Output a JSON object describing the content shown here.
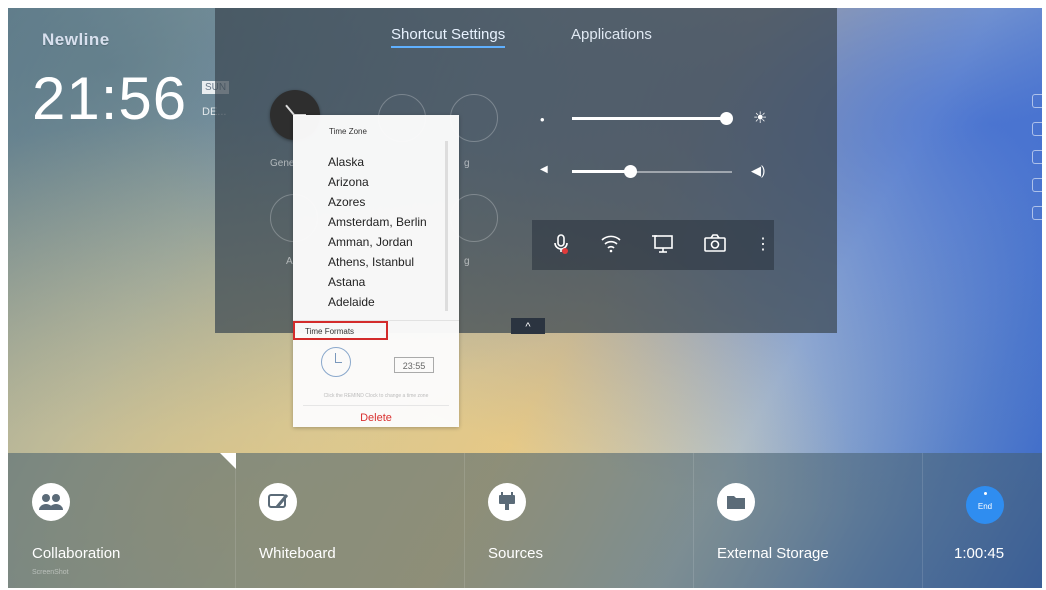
{
  "header": {
    "logo": "Newline",
    "time": "21:56",
    "day": "SUN",
    "date": "DE..."
  },
  "panel": {
    "tabs": [
      {
        "label": "Shortcut Settings",
        "active": true
      },
      {
        "label": "Applications",
        "active": false
      }
    ],
    "ghost_labels": [
      "Gene",
      "g",
      "A",
      "g"
    ],
    "brightness_level": 0.96,
    "volume_level": 0.36,
    "quick_icons": [
      "mic-muted-icon",
      "wifi-icon",
      "screen-cast-icon",
      "camera-icon",
      "more-vertical-icon"
    ],
    "collapse_glyph": "^"
  },
  "timezone_popup": {
    "title": "Time Zone",
    "zones": [
      "Alaska",
      "Arizona",
      "Azores",
      "Amsterdam, Berlin",
      "Amman, Jordan",
      "Athens, Istanbul",
      "Astana",
      "Adelaide"
    ],
    "time_formats_label": "Time Formats",
    "digital_sample": "23:55",
    "hint": "Click the REMIND Clock to change a time zone",
    "delete_label": "Delete"
  },
  "dock": {
    "items": [
      {
        "label": "Collaboration",
        "sublabel": "ScreenShot",
        "icon": "collaboration-icon"
      },
      {
        "label": "Whiteboard",
        "icon": "pen-icon"
      },
      {
        "label": "Sources",
        "icon": "sources-icon"
      },
      {
        "label": "External Storage",
        "icon": "folder-icon"
      }
    ],
    "end_label": "End",
    "timer": "1:00:45"
  },
  "colors": {
    "accent": "#2f8df0",
    "highlight_box": "#d32b2b",
    "delete": "#d93030"
  }
}
